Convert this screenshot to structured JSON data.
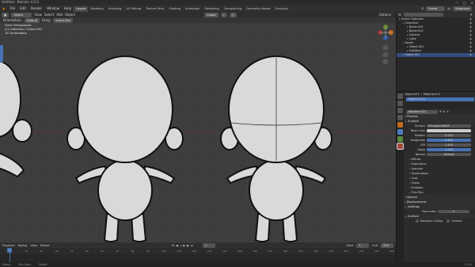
{
  "title_bar": {
    "text": "Untitled - Blender 4.0.0"
  },
  "menu": {
    "items": [
      "File",
      "Edit",
      "Render",
      "Window",
      "Help"
    ],
    "workspaces": [
      "Layout",
      "Modeling",
      "Sculpting",
      "UV Editing",
      "Texture Paint",
      "Shading",
      "Animation",
      "Rendering",
      "Compositing",
      "Geometry Nodes",
      "Scripting"
    ],
    "scene_label": "Scene",
    "viewlayer_label": "ViewLayer"
  },
  "viewport": {
    "header": {
      "mode": "Object Mode",
      "view": "View",
      "select": "Select",
      "add": "Add",
      "object": "Object",
      "orientation": "Global",
      "options": "Options"
    },
    "header2": {
      "orientation_label": "Orientation:",
      "orientation_value": "Default",
      "drag": "Drag:",
      "drag_value": "Select Box"
    },
    "info": [
      "Front Orthographic",
      "(1) Collection | Object.001",
      "10 Centimeters"
    ],
    "colors": {
      "background": "#3d3d3d",
      "model": "#d9d9d9",
      "outline": "#111111",
      "x_axis": "#9a3a3a",
      "y_axis": "#6a8a2a"
    }
  },
  "timeline": {
    "header": [
      "Playback",
      "Keying",
      "View",
      "Marker"
    ],
    "frame_start_label": "Start",
    "frame_start": "1",
    "frame_end_label": "End",
    "frame_end": "250",
    "current_frame": "1",
    "ticks": [
      "0",
      "10",
      "20",
      "30",
      "40",
      "50",
      "60",
      "70",
      "80",
      "90",
      "100",
      "110",
      "120",
      "130",
      "140",
      "150",
      "160",
      "170",
      "180",
      "190",
      "200",
      "210",
      "220",
      "230",
      "240",
      "250"
    ]
  },
  "status_bar": {
    "left": "Select",
    "mid": "Pan View",
    "right": "Object",
    "version": "4.0.0"
  },
  "outliner": {
    "title": "Scene Collection",
    "rows": [
      {
        "label": "Scene Collection",
        "indent": 0,
        "selected": false
      },
      {
        "label": "Collection",
        "indent": 1,
        "selected": false
      },
      {
        "label": "Bezier.001",
        "indent": 2,
        "selected": false
      },
      {
        "label": "Bezier.002",
        "indent": 2,
        "selected": false
      },
      {
        "label": "Camera",
        "indent": 2,
        "selected": false
      },
      {
        "label": "Light",
        "indent": 2,
        "selected": false
      },
      {
        "label": "Bezier",
        "indent": 1,
        "selected": false
      },
      {
        "label": "Object.001",
        "indent": 2,
        "selected": false
      },
      {
        "label": "Modifiers",
        "indent": 2,
        "selected": false
      },
      {
        "label": "Object.001",
        "indent": 1,
        "selected": true
      }
    ]
  },
  "properties": {
    "breadcrumb": [
      "Object.001",
      "Material.011"
    ],
    "slot": "Material.011",
    "material_name": "Material.011",
    "preview": "Preview",
    "surface_section": "Surface",
    "surface_label": "Surface",
    "surface_value": "Principled BSDF",
    "fields": [
      {
        "label": "Base Color",
        "value": "",
        "kind": "color"
      },
      {
        "label": "Metallic",
        "value": "0.000",
        "kind": "num"
      },
      {
        "label": "Roughness",
        "value": "0.500",
        "kind": "blue"
      },
      {
        "label": "IOR",
        "value": "1.450",
        "kind": "num"
      },
      {
        "label": "Alpha",
        "value": "1.000",
        "kind": "blue"
      },
      {
        "label": "Normal",
        "value": "Default",
        "kind": "num"
      }
    ],
    "subsections": [
      "Diffuse",
      "Subsurface",
      "Specular",
      "Transmission",
      "Coat",
      "Sheen",
      "Emission",
      "Thin Film"
    ],
    "volume": "Volume",
    "displacement": "Displacement",
    "settings": "Settings",
    "pass_index_label": "Pass Index",
    "pass_index": "0",
    "surface2": "Surface",
    "backface_label": "Backface Culling",
    "camera_label": "Camera"
  }
}
